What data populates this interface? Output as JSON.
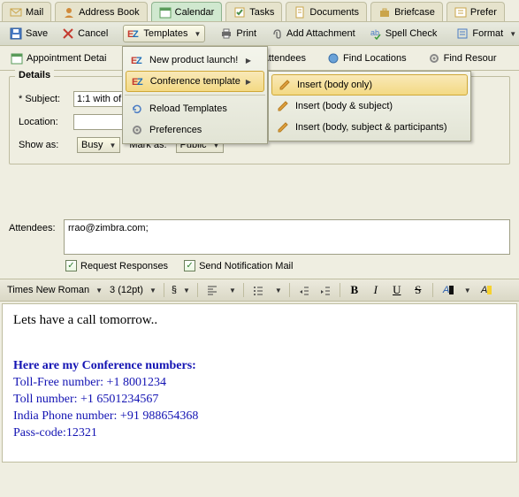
{
  "tabs": {
    "mail": "Mail",
    "address": "Address Book",
    "calendar": "Calendar",
    "tasks": "Tasks",
    "documents": "Documents",
    "briefcase": "Briefcase",
    "preferences": "Prefer"
  },
  "toolbar": {
    "save": "Save",
    "cancel": "Cancel",
    "templates": "Templates",
    "print": "Print",
    "add_attachment": "Add Attachment",
    "spellcheck": "Spell Check",
    "format": "Format"
  },
  "subtabs": {
    "appt": "Appointment Detai",
    "attendees_tab": "Attendees",
    "find_locations": "Find Locations",
    "find_resources": "Find Resour"
  },
  "details": {
    "legend": "Details",
    "subject_label": "* Subject:",
    "subject_value": "1:1 with of",
    "location_label": "Location:",
    "location_value": "",
    "showas_label": "Show as:",
    "showas_value": "Busy",
    "markas_label": "Mark as:",
    "markas_value": "Public"
  },
  "attendees": {
    "label": "Attendees:",
    "value": "rrao@zimbra.com;"
  },
  "checks": {
    "request": "Request Responses",
    "notify": "Send Notification Mail"
  },
  "editor_toolbar": {
    "font": "Times New Roman",
    "size": "3 (12pt)"
  },
  "editor_body": {
    "line1": "Lets have a call tomorrow..",
    "conf_title": "Here are my Conference numbers:",
    "conf_l1": "Toll-Free number: +1 8001234",
    "conf_l2": "Toll number: +1 6501234567",
    "conf_l3": "India Phone number: +91 988654368",
    "conf_l4": "Pass-code:12321"
  },
  "templates_menu": {
    "npl": "New product launch!",
    "conft": "Conference template",
    "reload": "Reload Templates",
    "prefs": "Preferences"
  },
  "insert_menu": {
    "body": "Insert (body only)",
    "body_subj": "Insert (body & subject)",
    "body_subj_part": "Insert (body, subject & participants)"
  }
}
